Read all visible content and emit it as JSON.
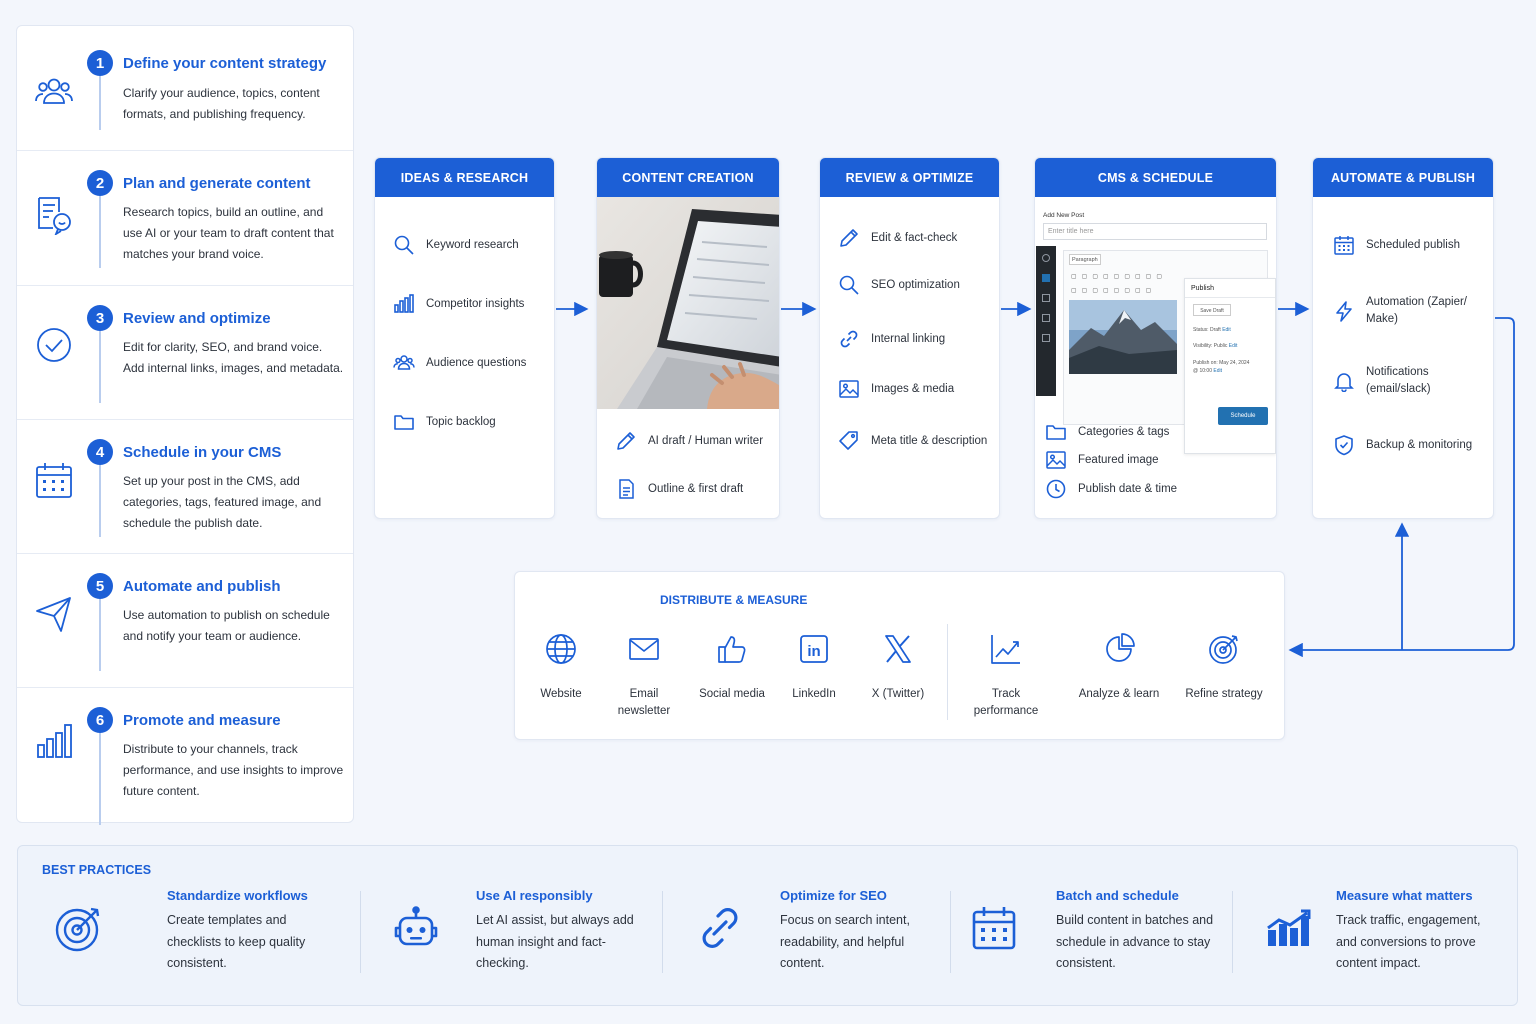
{
  "colors": {
    "accent": "#1c5fd6",
    "background": "#f3f6fc",
    "card": "#ffffff"
  },
  "steps": [
    {
      "number": "1",
      "title": "Define your content strategy",
      "description": "Clarify your audience, topics, content formats, and publishing frequency.",
      "icon": "users-icon"
    },
    {
      "number": "2",
      "title": "Plan and generate content",
      "description": "Research topics, build an outline, and use AI or your team to draft content that matches your brand voice.",
      "icon": "document-chat-icon"
    },
    {
      "number": "3",
      "title": "Review and optimize",
      "description": "Edit for clarity, SEO, and brand voice. Add internal links, images, and metadata.",
      "icon": "check-circle-icon"
    },
    {
      "number": "4",
      "title": "Schedule in your CMS",
      "description": "Set up your post in the CMS, add categories, tags, featured image, and schedule the publish date.",
      "icon": "calendar-icon"
    },
    {
      "number": "5",
      "title": "Automate and publish",
      "description": "Use automation to publish on schedule and notify your team or audience.",
      "icon": "send-icon"
    },
    {
      "number": "6",
      "title": "Promote and measure",
      "description": "Distribute to your channels, track performance, and use insights to improve future content.",
      "icon": "bar-chart-icon"
    }
  ],
  "stages": {
    "ideas": {
      "title": "IDEAS & RESEARCH",
      "items": [
        "Keyword research",
        "Competitor insights",
        "Audience questions",
        "Topic backlog"
      ]
    },
    "creation": {
      "title": "CONTENT CREATION",
      "items": [
        "AI draft / Human writer",
        "Outline & first draft"
      ]
    },
    "review": {
      "title": "REVIEW & OPTIMIZE",
      "items": [
        "Edit & fact-check",
        "SEO optimization",
        "Internal linking",
        "Images & media",
        "Meta title & description"
      ]
    },
    "cms": {
      "title": "CMS & SCHEDULE",
      "items": [
        "Categories & tags",
        "Featured image",
        "Publish date & time"
      ],
      "mock": {
        "heading": "Add New Post",
        "title_placeholder": "Enter title here",
        "paragraph": "Paragraph",
        "publish": "Publish",
        "save_draft": "Save Draft",
        "status": "Status: Draft",
        "visibility": "Visibility: Public",
        "edit": "Edit",
        "publish_on": "Publish on: May 24, 2024",
        "publish_time": "@ 10:00",
        "schedule": "Schedule"
      }
    },
    "automate": {
      "title": "AUTOMATE & PUBLISH",
      "items": [
        "Scheduled publish",
        "Automation (Zapier/ Make)",
        "Notifications (email/slack)",
        "Backup & monitoring"
      ]
    }
  },
  "distribute": {
    "title": "DISTRIBUTE & MEASURE",
    "channels": [
      "Website",
      "Email newsletter",
      "Social media",
      "LinkedIn",
      "X (Twitter)"
    ],
    "measure": [
      "Track performance",
      "Analyze & learn",
      "Refine strategy"
    ]
  },
  "best_practices": {
    "title": "BEST PRACTICES",
    "items": [
      {
        "title": "Standardize workflows",
        "description": "Create templates and checklists to keep quality consistent.",
        "icon": "target-icon"
      },
      {
        "title": "Use AI responsibly",
        "description": "Let AI assist, but always add human insight and fact-checking.",
        "icon": "robot-icon"
      },
      {
        "title": "Optimize for SEO",
        "description": "Focus on search intent, readability, and helpful content.",
        "icon": "link-icon"
      },
      {
        "title": "Batch and schedule",
        "description": "Build content in batches and schedule in advance to stay consistent.",
        "icon": "calendar-icon"
      },
      {
        "title": "Measure what matters",
        "description": "Track traffic, engagement, and conversions to prove content impact.",
        "icon": "growth-chart-icon"
      }
    ]
  }
}
